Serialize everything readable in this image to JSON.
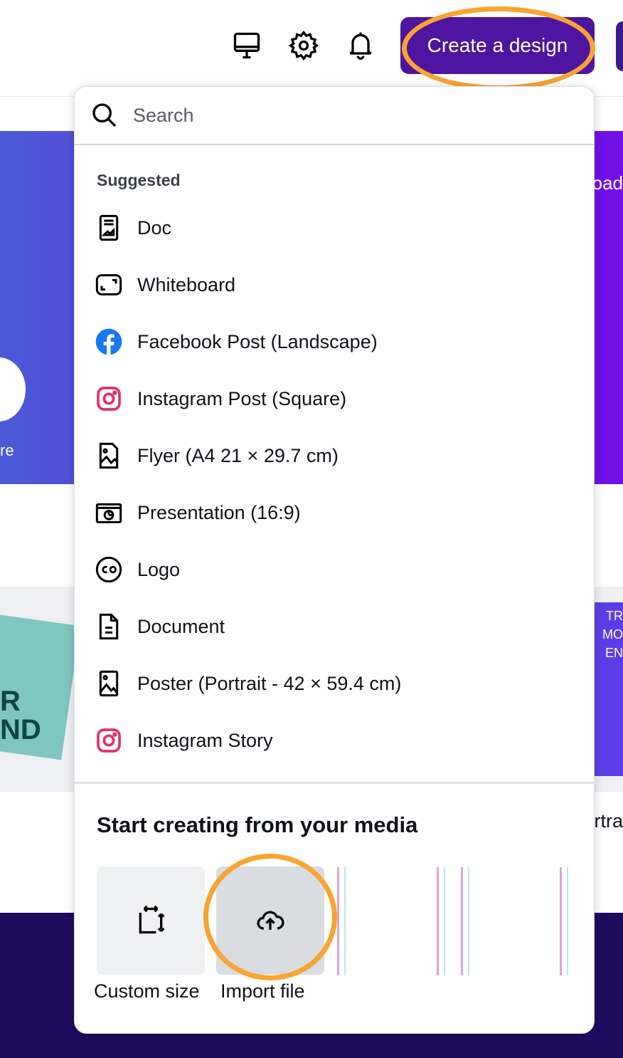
{
  "topbar": {
    "icons": [
      "desktop-icon",
      "settings-gear-icon",
      "notification-bell-icon"
    ],
    "create_label": "Create a design"
  },
  "background": {
    "left_label": "re",
    "right_label": "oad",
    "right_label2": "rtra",
    "card_text": "R\nND",
    "poster_text": "TR\nMO\nEN"
  },
  "menu": {
    "search_placeholder": "Search",
    "suggested_title": "Suggested",
    "items": [
      {
        "label": "Doc",
        "icon": "doc-icon"
      },
      {
        "label": "Whiteboard",
        "icon": "whiteboard-icon"
      },
      {
        "label": "Facebook Post (Landscape)",
        "icon": "facebook-icon"
      },
      {
        "label": "Instagram Post (Square)",
        "icon": "instagram-icon"
      },
      {
        "label": "Flyer (A4 21 × 29.7 cm)",
        "icon": "flyer-icon"
      },
      {
        "label": "Presentation (16:9)",
        "icon": "presentation-icon"
      },
      {
        "label": "Logo",
        "icon": "logo-icon"
      },
      {
        "label": "Document",
        "icon": "document-icon"
      },
      {
        "label": "Poster (Portrait - 42 × 59.4 cm)",
        "icon": "poster-icon"
      },
      {
        "label": "Instagram Story",
        "icon": "instagram-icon"
      }
    ],
    "media_title": "Start creating from your media",
    "custom_size_label": "Custom size",
    "import_file_label": "Import file"
  },
  "colors": {
    "accent": "#4e15a0",
    "highlight_ring": "#f8a432",
    "facebook": "#1877f2",
    "instagram": "#e1306c"
  }
}
